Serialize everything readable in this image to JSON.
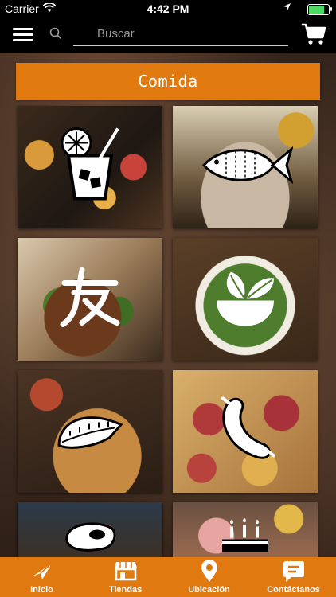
{
  "status_bar": {
    "carrier": "Carrier",
    "time": "4:42 PM",
    "battery_level": 0.85
  },
  "nav": {
    "search_placeholder": "Buscar"
  },
  "section": {
    "title": "Comida"
  },
  "tiles": [
    {
      "icon": "cocktail-icon"
    },
    {
      "icon": "fish-icon"
    },
    {
      "icon": "chinese-food-icon"
    },
    {
      "icon": "salad-icon"
    },
    {
      "icon": "empanada-icon"
    },
    {
      "icon": "sausage-icon"
    },
    {
      "icon": "steak-icon"
    },
    {
      "icon": "birthday-cake-icon"
    }
  ],
  "colors": {
    "accent": "#e07a10",
    "bar": "#000000"
  },
  "tabbar": [
    {
      "label": "Inicio",
      "icon": "paper-plane-icon"
    },
    {
      "label": "Tiendas",
      "icon": "store-icon"
    },
    {
      "label": "Ubicación",
      "icon": "map-pin-icon"
    },
    {
      "label": "Contáctanos",
      "icon": "chat-bubble-icon"
    }
  ]
}
